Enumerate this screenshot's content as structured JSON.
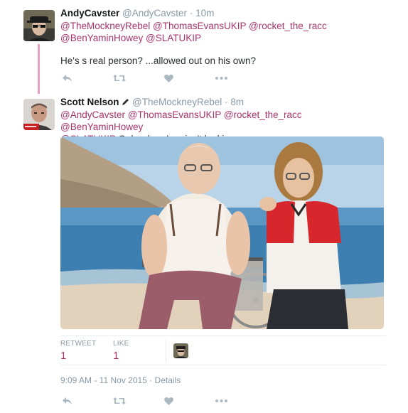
{
  "tweet1": {
    "fullname": "AndyCavster",
    "handle": "@AndyCavster",
    "sep": "·",
    "time": "10m",
    "mentions_line1": "@TheMockneyRebel @ThomasEvansUKIP @rocket_the_racc",
    "mentions_line2": "@BenYaminHowey @SLATUKIP",
    "text": "He's s real person? ...allowed out on his own?",
    "icons": [
      "reply-icon",
      "retweet-icon",
      "like-icon",
      "more-icon"
    ]
  },
  "tweet2": {
    "fullname": "Scott Nelson",
    "handle": "@TheMockneyRebel",
    "sep": "·",
    "time": "8m",
    "mentions_line1": "@AndyCavster @ThomasEvansUKIP @rocket_the_racc @BenYaminHowey",
    "mention_tail": "@SLATUKIP",
    "text_tail": "Only when Lou isn't looking",
    "stats": {
      "retweet_label": "RETWEET",
      "retweet_count": "1",
      "like_label": "LIKE",
      "like_count": "1"
    },
    "timestamp": "9:09 AM - 11 Nov 2015",
    "meta_sep": "·",
    "details": "Details",
    "icons": [
      "reply-icon",
      "retweet-icon",
      "like-icon",
      "more-icon"
    ]
  },
  "colors": {
    "accent": "#a8336b",
    "muted": "#8899a6",
    "thread_line": "#e7a0c6"
  }
}
